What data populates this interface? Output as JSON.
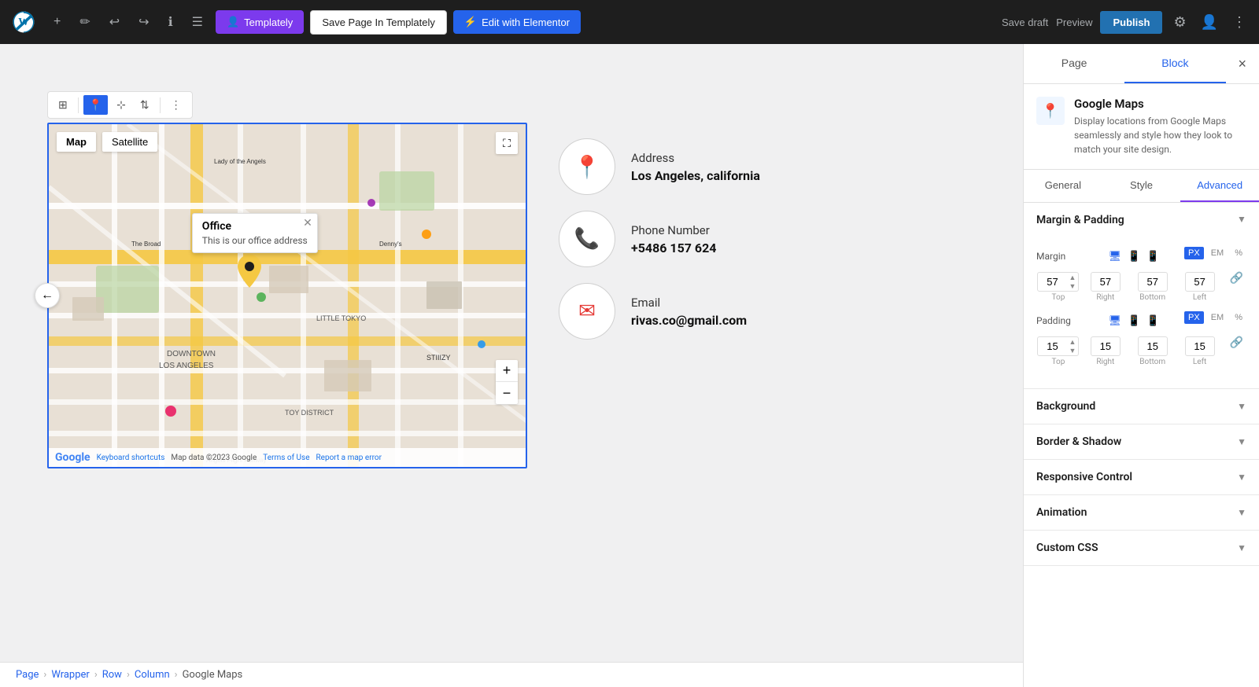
{
  "topbar": {
    "templately_label": "Templately",
    "save_page_label": "Save Page In Templately",
    "edit_elementor_label": "Edit with Elementor",
    "save_draft_label": "Save draft",
    "preview_label": "Preview",
    "publish_label": "Publish"
  },
  "toolbar": {
    "layout_icon": "⊞",
    "move_icon": "⊹",
    "arrows_icon": "⇅",
    "more_icon": "⋮"
  },
  "map": {
    "tab_map": "Map",
    "tab_satellite": "Satellite",
    "popup_title": "Office",
    "popup_text": "This is our office address",
    "footer_keyboard": "Keyboard shortcuts",
    "footer_mapdata": "Map data ©2023 Google",
    "footer_terms": "Terms of Use",
    "footer_report": "Report a map error",
    "zoom_in": "+",
    "zoom_out": "−"
  },
  "contact": {
    "address_label": "Address",
    "address_value": "Los Angeles, california",
    "phone_label": "Phone Number",
    "phone_value": "+5486 157 624",
    "email_label": "Email",
    "email_value": "rivas.co@gmail.com"
  },
  "breadcrumb": {
    "page": "Page",
    "wrapper": "Wrapper",
    "row": "Row",
    "column": "Column",
    "block": "Google Maps"
  },
  "sidebar": {
    "tab_page": "Page",
    "tab_block": "Block",
    "close_label": "×",
    "block_name": "Google Maps",
    "block_desc": "Display locations from Google Maps seamlessly and style how they look to match your site design.",
    "sub_tab_general": "General",
    "sub_tab_style": "Style",
    "sub_tab_advanced": "Advanced",
    "margin_padding_title": "Margin & Padding",
    "margin_label": "Margin",
    "padding_label": "Padding",
    "margin_top": "57",
    "margin_right": "57",
    "margin_bottom": "57",
    "margin_left": "57",
    "padding_top": "15",
    "padding_right": "15",
    "padding_bottom": "15",
    "padding_left": "15",
    "unit_px": "PX",
    "unit_em": "EM",
    "unit_pct": "%",
    "top_label": "Top",
    "right_label": "Right",
    "bottom_label": "Bottom",
    "left_label": "Left",
    "background_title": "Background",
    "border_shadow_title": "Border & Shadow",
    "responsive_title": "Responsive Control",
    "animation_title": "Animation",
    "custom_css_title": "Custom CSS"
  }
}
